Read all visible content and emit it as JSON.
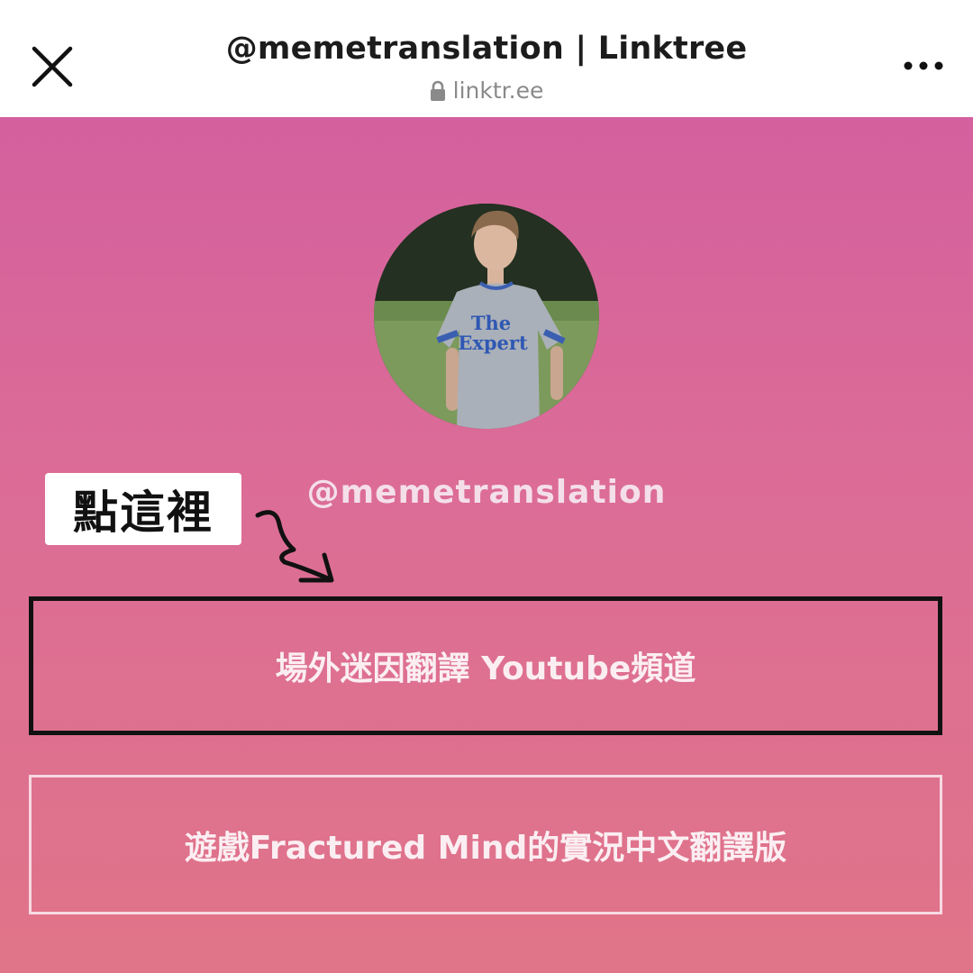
{
  "header": {
    "title": "@memetranslation | Linktree",
    "url": "linktr.ee",
    "close_icon": "close-icon",
    "lock_icon": "lock-icon",
    "more_icon": "more-horizontal-icon"
  },
  "profile": {
    "avatar_shirt_line1": "The",
    "avatar_shirt_line2": "Expert",
    "username": "@memetranslation"
  },
  "annotation": {
    "sticker_text": "點這裡",
    "arrow_icon": "hand-drawn-arrow-icon"
  },
  "links": [
    {
      "label": "場外迷因翻譯 Youtube頻道"
    },
    {
      "label": "遊戲Fractured Mind的實況中文翻譯版"
    }
  ],
  "colors": {
    "gradient_top": "#d4609e",
    "gradient_bottom": "#e07488",
    "highlight_border": "#111111",
    "button_border": "#f7d8e2"
  }
}
